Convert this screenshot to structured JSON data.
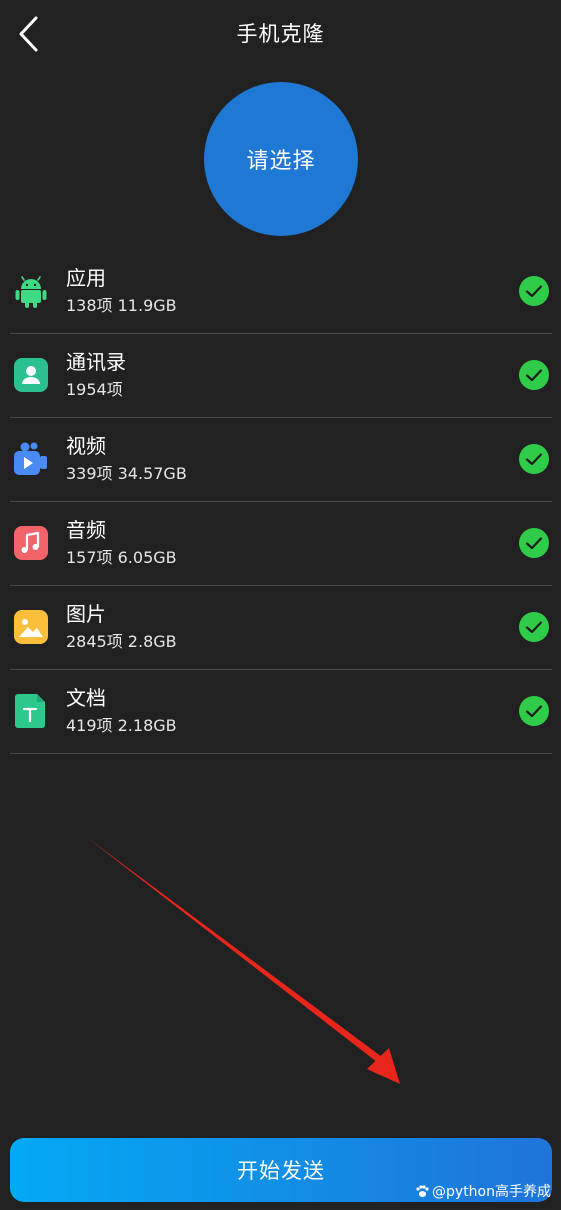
{
  "header": {
    "title": "手机克隆",
    "back_icon": "chevron-left-icon"
  },
  "select_button": {
    "label": "请选择",
    "color": "#1f78d4"
  },
  "categories": [
    {
      "name": "应用",
      "meta": "138项 11.9GB",
      "icon": "android-icon",
      "checked": true
    },
    {
      "name": "通讯录",
      "meta": "1954项",
      "icon": "contacts-icon",
      "checked": true
    },
    {
      "name": "视频",
      "meta": "339项 34.57GB",
      "icon": "video-icon",
      "checked": true
    },
    {
      "name": "音频",
      "meta": "157项 6.05GB",
      "icon": "music-icon",
      "checked": true
    },
    {
      "name": "图片",
      "meta": "2845项 2.8GB",
      "icon": "image-icon",
      "checked": true
    },
    {
      "name": "文档",
      "meta": "419项 2.18GB",
      "icon": "document-icon",
      "checked": true
    }
  ],
  "start_button": {
    "label": "开始发送"
  },
  "watermark": {
    "text": "@python高手养成"
  },
  "colors": {
    "background": "#212121",
    "check_green": "#2ecc48",
    "annotation_red": "#e8261c"
  }
}
